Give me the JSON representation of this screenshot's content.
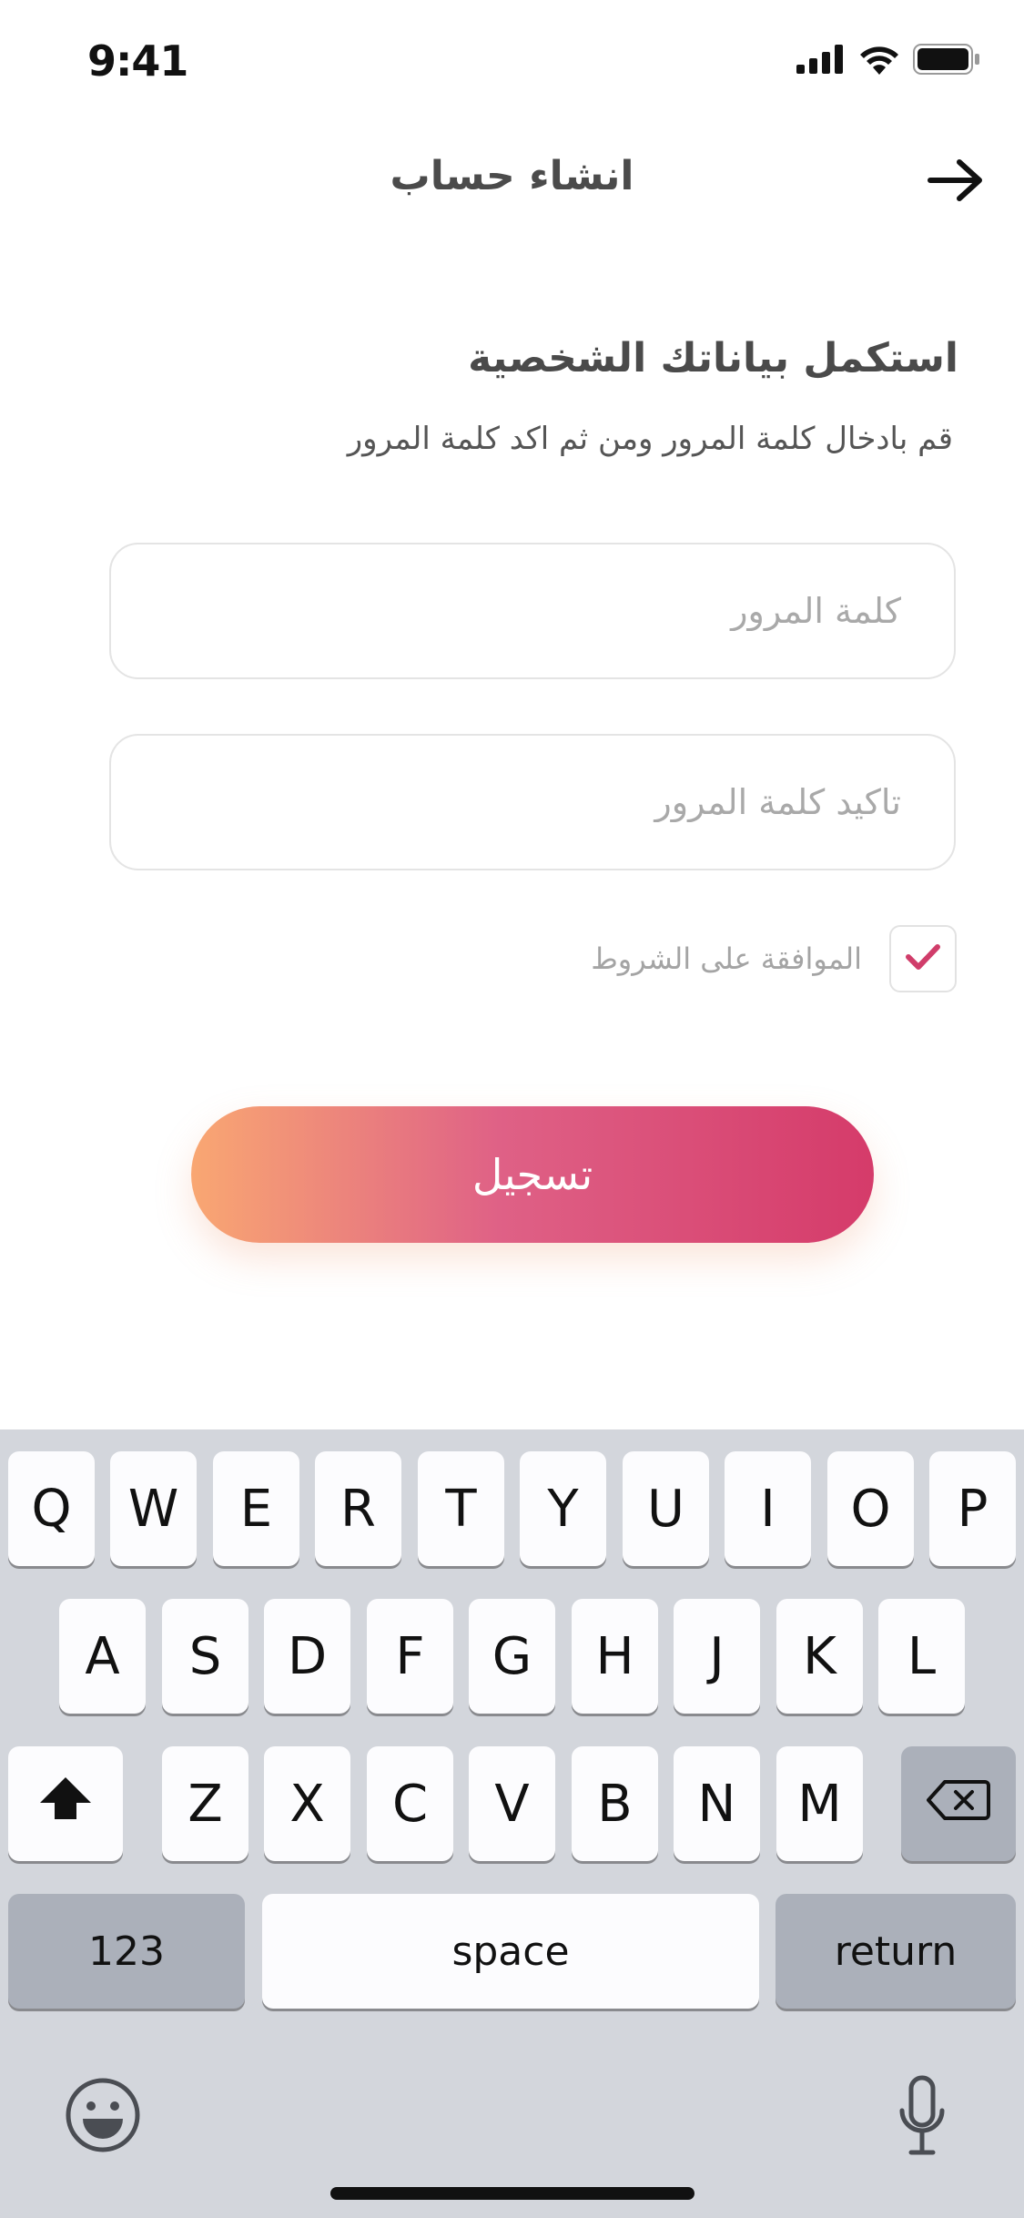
{
  "status_bar": {
    "time": "9:41"
  },
  "header": {
    "title": "انشاء حساب"
  },
  "form": {
    "title": "استكمل بياناتك الشخصية",
    "subtitle": "قم بادخال كلمة المرور ومن ثم اكد كلمة المرور",
    "password_placeholder": "كلمة المرور",
    "confirm_placeholder": "تاكيد كلمة المرور",
    "terms_label": "الموافقة على الشروط",
    "terms_checked": true,
    "submit_label": "تسجيل"
  },
  "keyboard": {
    "row1": [
      "Q",
      "W",
      "E",
      "R",
      "T",
      "Y",
      "U",
      "I",
      "O",
      "P"
    ],
    "row2": [
      "A",
      "S",
      "D",
      "F",
      "G",
      "H",
      "J",
      "K",
      "L"
    ],
    "row3": [
      "Z",
      "X",
      "C",
      "V",
      "B",
      "N",
      "M"
    ],
    "numbers_label": "123",
    "space_label": "space",
    "return_label": "return"
  },
  "colors": {
    "accent_start": "#f9a772",
    "accent_end": "#d53b6a",
    "check": "#d03d6a"
  },
  "icons": [
    "signal-icon",
    "wifi-icon",
    "battery-icon",
    "arrow-right-icon",
    "checkmark-icon",
    "shift-icon",
    "backspace-icon",
    "emoji-icon",
    "microphone-icon"
  ]
}
